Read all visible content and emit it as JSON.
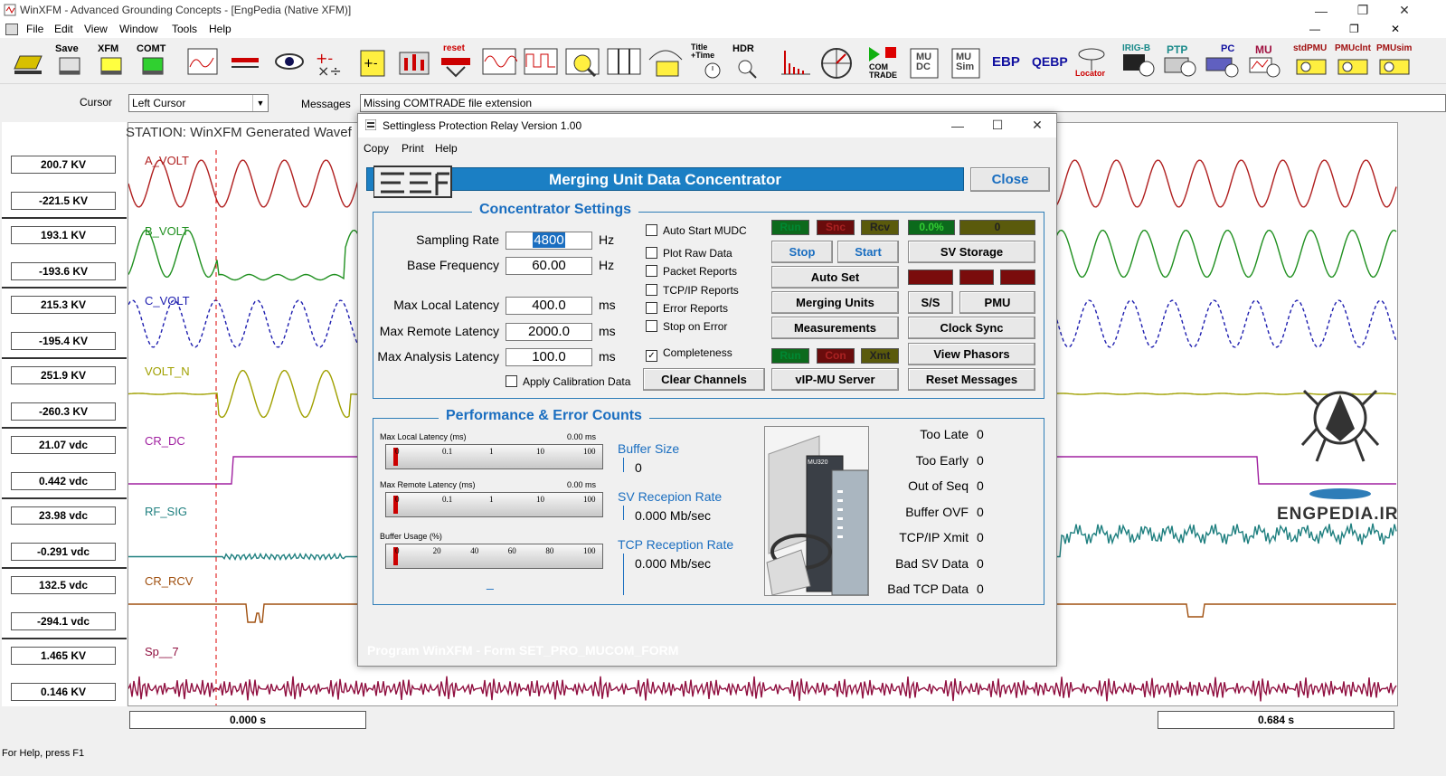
{
  "app": {
    "title": "WinXFM - Advanced Grounding Concepts - [EngPedia (Native XFM)]",
    "menu": [
      "File",
      "Edit",
      "View",
      "Window",
      "Tools",
      "Help"
    ]
  },
  "toolbar": {
    "labels": [
      "Save",
      "XFM",
      "COMT",
      "reset",
      "Title\n+Time",
      "HDR",
      "COM\nTRADE",
      "MU\nDC",
      "MU\nSim",
      "EBP",
      "QEBP",
      "Locator",
      "IRIG-B",
      "PTP",
      "PC",
      "MU",
      "stdPMU",
      "PMUclnt",
      "PMUsim"
    ]
  },
  "cursor_row": {
    "cursor_label": "Cursor",
    "cursor_value": "Left Cursor",
    "messages_label": "Messages",
    "messages_value": "Missing COMTRADE file extension"
  },
  "station": "STATION: WinXFM Generated Wavef",
  "channels": [
    {
      "name": "A_VOLT",
      "max": "200.7 KV",
      "min": "-221.5 KV",
      "color": "#b02020"
    },
    {
      "name": "B_VOLT",
      "max": "193.1 KV",
      "min": "-193.6 KV",
      "color": "#209020"
    },
    {
      "name": "C_VOLT",
      "max": "215.3 KV",
      "min": "-195.4 KV",
      "color": "#2020b0"
    },
    {
      "name": "VOLT_N",
      "max": "251.9 KV",
      "min": "-260.3 KV",
      "color": "#a0a000"
    },
    {
      "name": "CR_DC",
      "max": "21.07 vdc",
      "min": "0.442 vdc",
      "color": "#a020a0"
    },
    {
      "name": "RF_SIG",
      "max": "23.98 vdc",
      "min": "-0.291 vdc",
      "color": "#208080"
    },
    {
      "name": "CR_RCV",
      "max": "132.5 vdc",
      "min": "-294.1 vdc",
      "color": "#a05010"
    },
    {
      "name": "Sp__7",
      "max": "1.465 KV",
      "min": "0.146 KV",
      "color": "#901040"
    }
  ],
  "time_left": "0.000 s",
  "time_right": "0.684 s",
  "status": "For Help, press F1",
  "watermark": "ENGPEDIA.IR",
  "dialog": {
    "title": "Settingless Protection Relay Version 1.00",
    "menu": [
      "Copy",
      "Print",
      "Help"
    ],
    "banner": "Merging Unit Data Concentrator",
    "close_label": "Close",
    "settings_title": "Concentrator Settings",
    "fields": [
      {
        "label": "Sampling Rate",
        "value": "4800",
        "unit": "Hz"
      },
      {
        "label": "Base Frequency",
        "value": "60.00",
        "unit": "Hz"
      },
      {
        "label": "Max Local Latency",
        "value": "400.0",
        "unit": "ms"
      },
      {
        "label": "Max Remote Latency",
        "value": "2000.0",
        "unit": "ms"
      },
      {
        "label": "Max Analysis Latency",
        "value": "100.0",
        "unit": "ms"
      }
    ],
    "apply_cal": "Apply Calibration Data",
    "checkboxes": [
      {
        "label": "Auto Start MUDC",
        "checked": ""
      },
      {
        "label": "Plot Raw Data",
        "checked": ""
      },
      {
        "label": "Packet Reports",
        "checked": ""
      },
      {
        "label": "TCP/IP Reports",
        "checked": ""
      },
      {
        "label": "Error Reports",
        "checked": ""
      },
      {
        "label": "Stop on Error",
        "checked": ""
      },
      {
        "label": "Completeness",
        "checked": "✓"
      }
    ],
    "indicators_top": [
      "Run",
      "Snc",
      "Rcv"
    ],
    "indicator_pct": "0.0%",
    "indicator_count": "0",
    "indicators_bottom": [
      "Run",
      "Con",
      "Xmt"
    ],
    "buttons": {
      "stop": "Stop",
      "start": "Start",
      "sv_storage": "SV Storage",
      "auto_set": "Auto Set",
      "merging_units": "Merging Units",
      "ss": "S/S",
      "pmu": "PMU",
      "measurements": "Measurements",
      "clock_sync": "Clock Sync",
      "view_phasors": "View Phasors",
      "clear_channels": "Clear Channels",
      "vip_mu_server": "vIP-MU Server",
      "reset_messages": "Reset Messages"
    },
    "perf_title": "Performance & Error Counts",
    "meters": [
      {
        "label": "Max Local Latency  (ms)",
        "value": "0.00 ms",
        "ticks": [
          "0",
          "0.1",
          "1",
          "10",
          "100"
        ]
      },
      {
        "label": "Max Remote Latency  (ms)",
        "value": "0.00 ms",
        "ticks": [
          "0",
          "0.1",
          "1",
          "10",
          "100"
        ]
      },
      {
        "label": "Buffer Usage (%)",
        "value": "",
        "ticks": [
          "0",
          "20",
          "40",
          "60",
          "80",
          "100"
        ]
      }
    ],
    "meter_footer": "_",
    "buffer_size_label": "Buffer Size",
    "buffer_size": "0",
    "sv_rate_label": "SV Recepion Rate",
    "sv_rate": "0.000 Mb/sec",
    "tcp_rate_label": "TCP Reception Rate",
    "tcp_rate": "0.000  Mb/sec",
    "device_label": "MU320",
    "counts": [
      {
        "label": "Too Late",
        "value": "0"
      },
      {
        "label": "Too Early",
        "value": "0"
      },
      {
        "label": "Out of Seq",
        "value": "0"
      },
      {
        "label": "Buffer OVF",
        "value": "0"
      },
      {
        "label": "TCP/IP Xmit",
        "value": "0"
      },
      {
        "label": "Bad SV Data",
        "value": "0"
      },
      {
        "label": "Bad TCP Data",
        "value": "0"
      }
    ],
    "footer_ghost": "Program WinXFM - Form SET_PRO_MUCOM_FORM"
  }
}
